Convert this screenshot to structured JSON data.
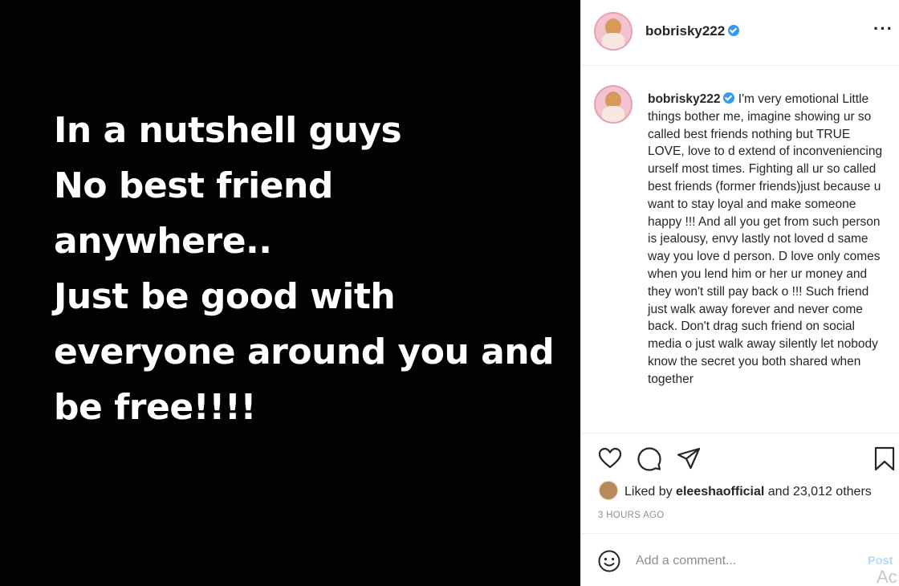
{
  "post": {
    "image_text": [
      "In a nutshell guys",
      "No best friend",
      "anywhere..",
      "Just be good with",
      "everyone around you and",
      "be free!!!!"
    ]
  },
  "header": {
    "username": "bobrisky222",
    "more_label": "···"
  },
  "caption": {
    "username": "bobrisky222",
    "text": "I'm very emotional Little things bother me, imagine showing ur so called best friends nothing but TRUE LOVE, love to d extend of inconveniencing urself most times. Fighting all ur so called best friends (former friends)just because u want to stay loyal and make someone happy !!! And all you get from such person is jealousy, envy lastly not loved d same way you love d person. D love only comes when you lend him or her ur money and they won't still pay back o !!! Such friend just walk away forever and never come back. Don't drag such friend on social media o just walk away silently let nobody know the secret you both shared when together"
  },
  "likes": {
    "prefix": "Liked by",
    "user": "eleeshaofficial",
    "suffix": "and 23,012 others"
  },
  "timestamp": "3 HOURS AGO",
  "comment": {
    "placeholder": "Add a comment...",
    "post_label": "Post",
    "watermark": "Ac"
  },
  "icons": {
    "like": "heart-icon",
    "comment": "comment-icon",
    "share": "paper-plane-icon",
    "save": "bookmark-icon",
    "emoji": "smiley-icon",
    "verified": "verified-badge-icon",
    "more": "more-options-icon"
  },
  "colors": {
    "verified": "#3897f0",
    "post_button_disabled": "#b3dbff",
    "muted_text": "#8e8e8e"
  }
}
